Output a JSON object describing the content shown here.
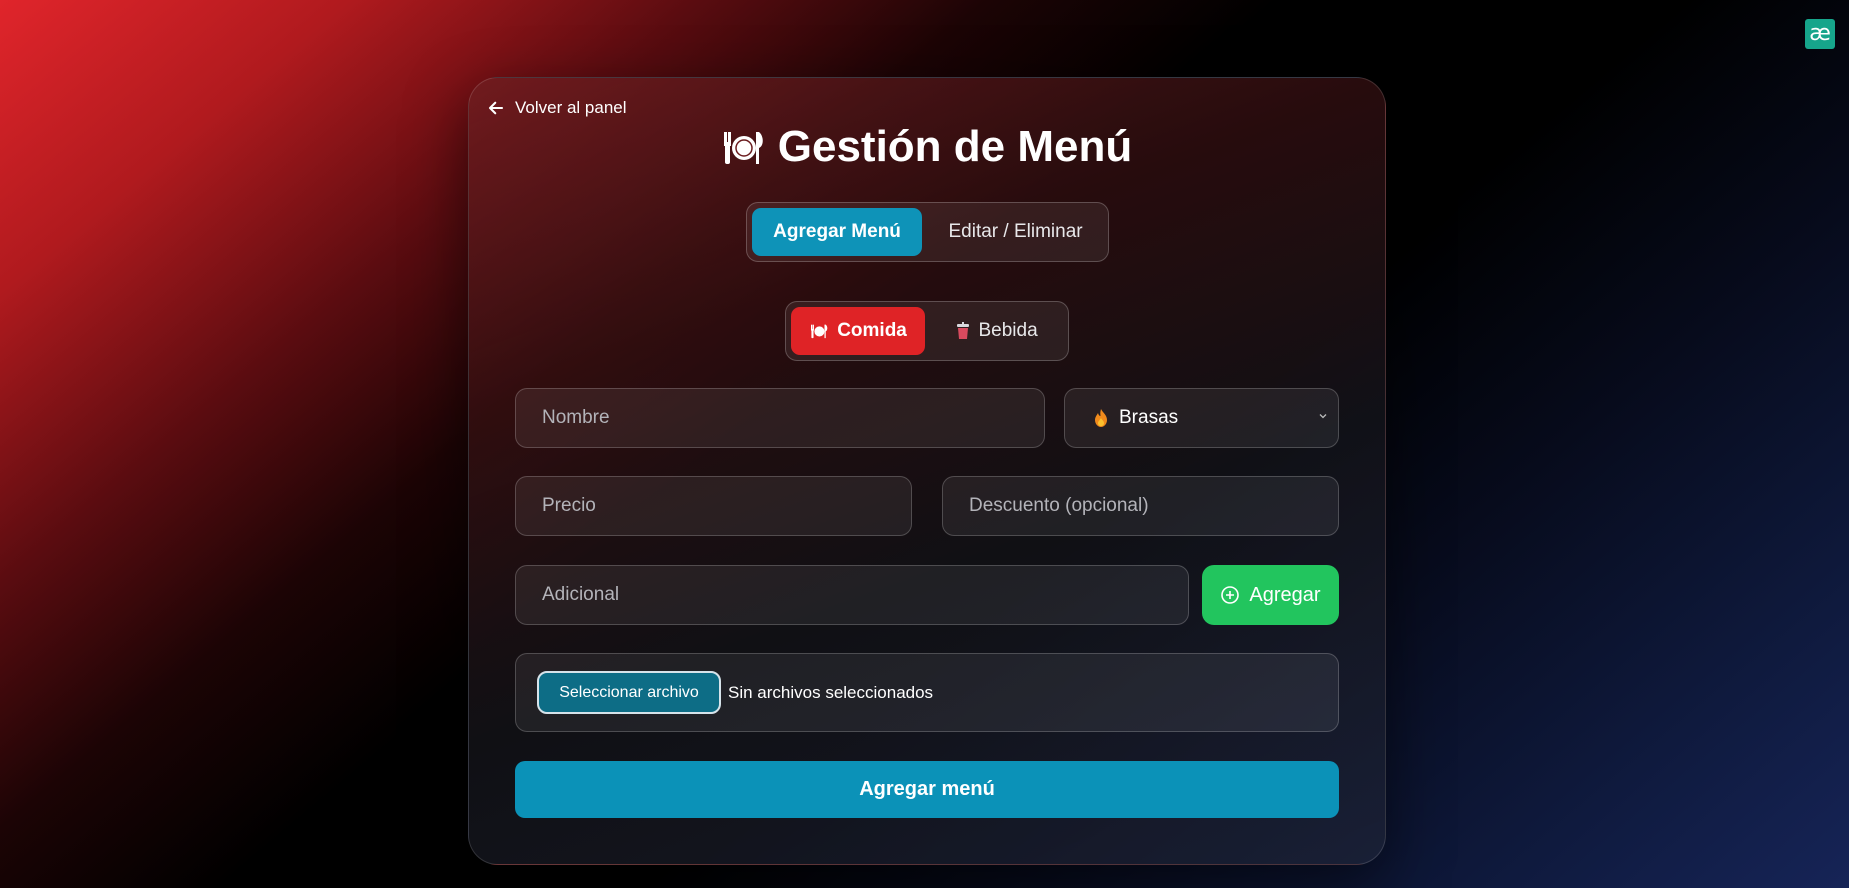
{
  "corner_logo": {
    "glyph": "æ",
    "color": "#16a58b"
  },
  "header": {
    "back_label": "Volver al panel",
    "title": "Gestión de Menú"
  },
  "tabs": [
    {
      "label": "Agregar Menú",
      "active": true
    },
    {
      "label": "Editar / Eliminar",
      "active": false
    }
  ],
  "type_toggle": [
    {
      "label": "Comida",
      "icon": "plate-icon",
      "active": true
    },
    {
      "label": "Bebida",
      "icon": "cup-icon",
      "active": false
    }
  ],
  "form": {
    "nombre_placeholder": "Nombre",
    "category_selected": "Brasas",
    "category_icon": "fire-icon",
    "precio_placeholder": "Precio",
    "descuento_placeholder": "Descuento (opcional)",
    "adicional_placeholder": "Adicional",
    "add_extra_label": "Agregar",
    "file_button_label": "Seleccionar archivo",
    "file_status": "Sin archivos seleccionados",
    "submit_label": "Agregar menú"
  },
  "colors": {
    "primary_blue": "#0e93b8",
    "active_red": "#df2326",
    "success_green": "#22c55e"
  }
}
